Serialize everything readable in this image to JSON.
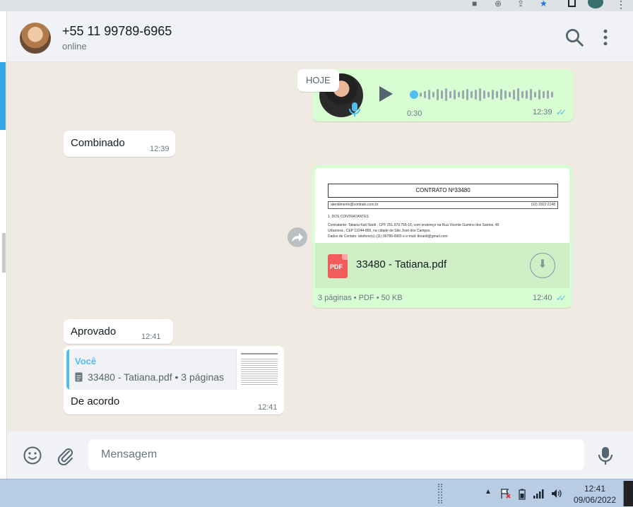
{
  "contact": {
    "name": "+55 11 99789-6965",
    "status": "online"
  },
  "date_chip": "HOJE",
  "messages": {
    "audio": {
      "duration": "0:30",
      "time": "12:39",
      "progress": 0
    },
    "combinado": {
      "text": "Combinado",
      "time": "12:39"
    },
    "document": {
      "preview_title": "CONTRATO Nº33480",
      "preview_email": "atendimento@contrato.com.br",
      "preview_phone": "(12) 3322-2148",
      "preview_section": "1. DOS CONTRATANTES",
      "preview_line1": "Contratante: Tatiana Kati Nardi , CPF 251.979.755-16, com endereço na Rua Vicente Gumino dos Santos, 49",
      "preview_line2": "Urbanova , CEP 12244-865, na cidade de São José dos Campos.",
      "preview_line3": "Dados de Contato: telefone(s) (11) 99789-6965 e e-mail: tknardi@gmail.com",
      "pdf_label": "PDF",
      "file_name": "33480 - Tatiana.pdf",
      "meta": "3 páginas • PDF • 50 KB",
      "time": "12:40"
    },
    "aprovado": {
      "text": "Aprovado",
      "time": "12:41"
    },
    "reply": {
      "quote_author": "Você",
      "quote_text": "33480 - Tatiana.pdf • 3 páginas",
      "text": "De acordo",
      "time": "12:41"
    }
  },
  "composer": {
    "placeholder": "Mensagem"
  },
  "taskbar": {
    "time": "12:41",
    "date": "09/06/2022"
  },
  "icons": {
    "header": [
      "search-icon",
      "more-vert-icon"
    ],
    "footer": [
      "emoji-icon",
      "attach-icon",
      "mic-icon"
    ],
    "message": [
      "play-icon",
      "mic-badge-icon",
      "pdf-icon",
      "download-icon",
      "forward-icon",
      "read-ticks-icon",
      "document-icon"
    ],
    "browser": [
      "camera-icon",
      "zoom-icon",
      "share-icon",
      "star-icon",
      "extension-icon",
      "profile-icon",
      "menu-icon"
    ],
    "tray": [
      "chevron-up-icon",
      "flag-icon",
      "battery-icon",
      "signal-icon",
      "volume-icon"
    ]
  },
  "colors": {
    "outgoing_bubble": "#d9fdd3",
    "incoming_bubble": "#ffffff",
    "read_ticks": "#53bdeb",
    "chat_background": "#efeae2",
    "pdf_red": "#f15c5c"
  }
}
